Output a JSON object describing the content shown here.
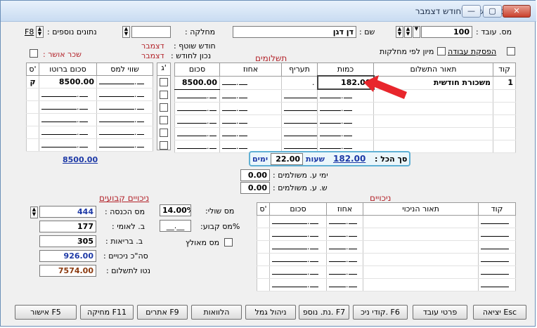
{
  "window": {
    "title": "הכנת השכר לחודש דצמבר",
    "btn_min": "—",
    "btn_max": "▢",
    "btn_close": "✕"
  },
  "header": {
    "employee_no_label": "מס. עובד :",
    "employee_no": "100",
    "name_label": "שם :",
    "name": "דן דגן",
    "department_label": "מחלקה :",
    "department": "",
    "extra_data_label": "נתונים נוספים :",
    "extra_data_key": "F8",
    "shared_month_label": "חודש שוטף :",
    "shared_month": "דצמבר",
    "correct_month_label": "נכון לחודש :",
    "correct_month": "דצמבר",
    "approved_pay_label": "שכר אושר :",
    "stop_work_label": "הפסקת עבודה",
    "sort_by_dept_label": "מיון לפי מחלקות"
  },
  "payments": {
    "section_title": "תשלומים",
    "columns": [
      "קוד",
      "תאור התשלום",
      "כמות",
      "תעריף",
      "אחוז",
      "סכום",
      "ג'",
      "שווי למס",
      "סכום ברוטו",
      "ס'"
    ],
    "rows": [
      {
        "code": "1",
        "desc": "משכורת חודשית",
        "qty": "182.00",
        "rate": ".",
        "pct": "",
        "amount": "8500.00",
        "tax_value": "",
        "gross": "8500.00",
        "s": "ק"
      }
    ],
    "gross_total": "8500.00"
  },
  "totals": {
    "total_label": "סך הכל :",
    "hours_value": "182.00",
    "hours_label": "שעות",
    "days_value": "22.00",
    "days_label": "ימים",
    "paid_days_label": "ימי ע. משולמים :",
    "paid_days": "0.00",
    "paid_hours_label": "ש. ע. משולמים :",
    "paid_hours": "0.00"
  },
  "fixed_deductions": {
    "title": "ניכויים קבועים",
    "income_tax_label": "מס הכנסה :",
    "income_tax": "444",
    "national_ins_label": "ב. לאומי :",
    "national_ins": "177",
    "health_ins_label": "ב. בריאות :",
    "health_ins": "305",
    "total_deductions_label": "סה\"כ ניכויים :",
    "total_deductions": "926.00",
    "net_pay_label": "נטו לתשלום :",
    "net_pay": "7574.00"
  },
  "tax": {
    "marginal_label": "מס שולי:",
    "marginal": "14.00%",
    "fixed_pct_label": "%מס קבוע:",
    "fixed_pct": "__.__",
    "grossed_up_label": "מס מאולץ"
  },
  "deductions": {
    "title": "ניכויים",
    "columns": [
      "קוד",
      "תאור הניכוי",
      "אחוז",
      "סכום",
      "ס'"
    ]
  },
  "buttons": {
    "exit": "יציאה Esc",
    "employee_details": "פרטי עובד",
    "deduction_codes": "קודי ניכ. F6",
    "additional_data": "נת. נוספ. F7",
    "provident_mgmt": "ניהול גמל",
    "loans": "הלוואות",
    "sites": "אתרים F9",
    "delete": "מחיקה F11",
    "approve": "אישור F5"
  }
}
